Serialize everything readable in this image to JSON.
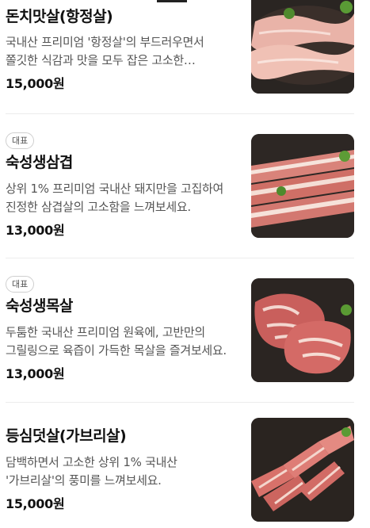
{
  "items": [
    {
      "badge": "",
      "name": "돈치맛살(항정살)",
      "description": "국내산 프리미엄 '항정살'의 부드러우면서 쫄깃한 식감과 맛을 모두 잡은 고소한 부위입니다.",
      "price": "15,000원",
      "image_icon": "pork-jowl-photo"
    },
    {
      "badge": "대표",
      "name": "숙성생삼겹",
      "description": "상위 1% 프리미엄 국내산 돼지만을 고집하여 진정한 삼겹살의 고소함을 느껴보세요.",
      "price": "13,000원",
      "image_icon": "pork-belly-photo"
    },
    {
      "badge": "대표",
      "name": "숙성생목살",
      "description": "두툼한 국내산 프리미엄 원육에, 고반만의 그릴링으로 육즙이 가득한 목살을 즐겨보세요.",
      "price": "13,000원",
      "image_icon": "pork-neck-photo"
    },
    {
      "badge": "",
      "name": "등심덧살(가브리살)",
      "description": "담백하면서 고소한 상위 1% 국내산 '가브리살'의 풍미를 느껴보세요.",
      "price": "15,000원",
      "image_icon": "pork-rib-finger-photo"
    }
  ]
}
